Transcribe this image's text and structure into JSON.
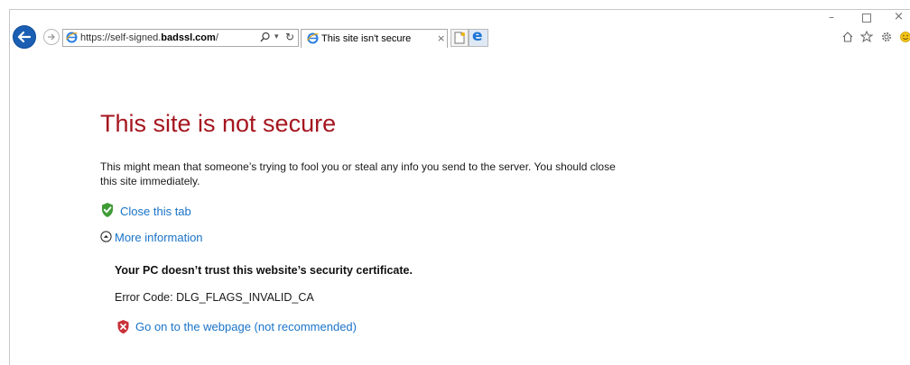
{
  "browser": {
    "url_prefix": "https://self-signed.",
    "url_domain": "badssl.com",
    "url_suffix": "/",
    "tab_title": "This site isn't secure",
    "tab_close": "×",
    "refresh_glyph": "↻",
    "dropdown_glyph": "▾",
    "window": {
      "minimize": "–",
      "close": "×"
    }
  },
  "content": {
    "heading": "This site is not secure",
    "paragraph": "This might mean that someone’s trying to fool you or steal any info you send to the server. You should close this site immediately.",
    "close_tab_label": "Close this tab",
    "more_info_label": "More information",
    "trust_message": "Your PC doesn’t trust this website’s security certificate.",
    "error_code": "Error Code: DLG_FLAGS_INVALID_CA",
    "go_on_label": "Go on to the webpage (not recommended)"
  },
  "colors": {
    "heading": "#a5161f",
    "link": "#1a73c8",
    "back_button": "#1a5fb4",
    "safe_shield": "#3e9c35",
    "danger_shield": "#c8323a"
  },
  "icons": [
    "back-arrow-icon",
    "forward-arrow-icon",
    "ie-icon",
    "search-icon",
    "refresh-icon",
    "new-tab-icon",
    "edge-icon",
    "home-icon",
    "star-icon",
    "gear-icon",
    "smile-icon",
    "shield-check-icon",
    "collapse-circle-icon",
    "shield-x-icon"
  ]
}
